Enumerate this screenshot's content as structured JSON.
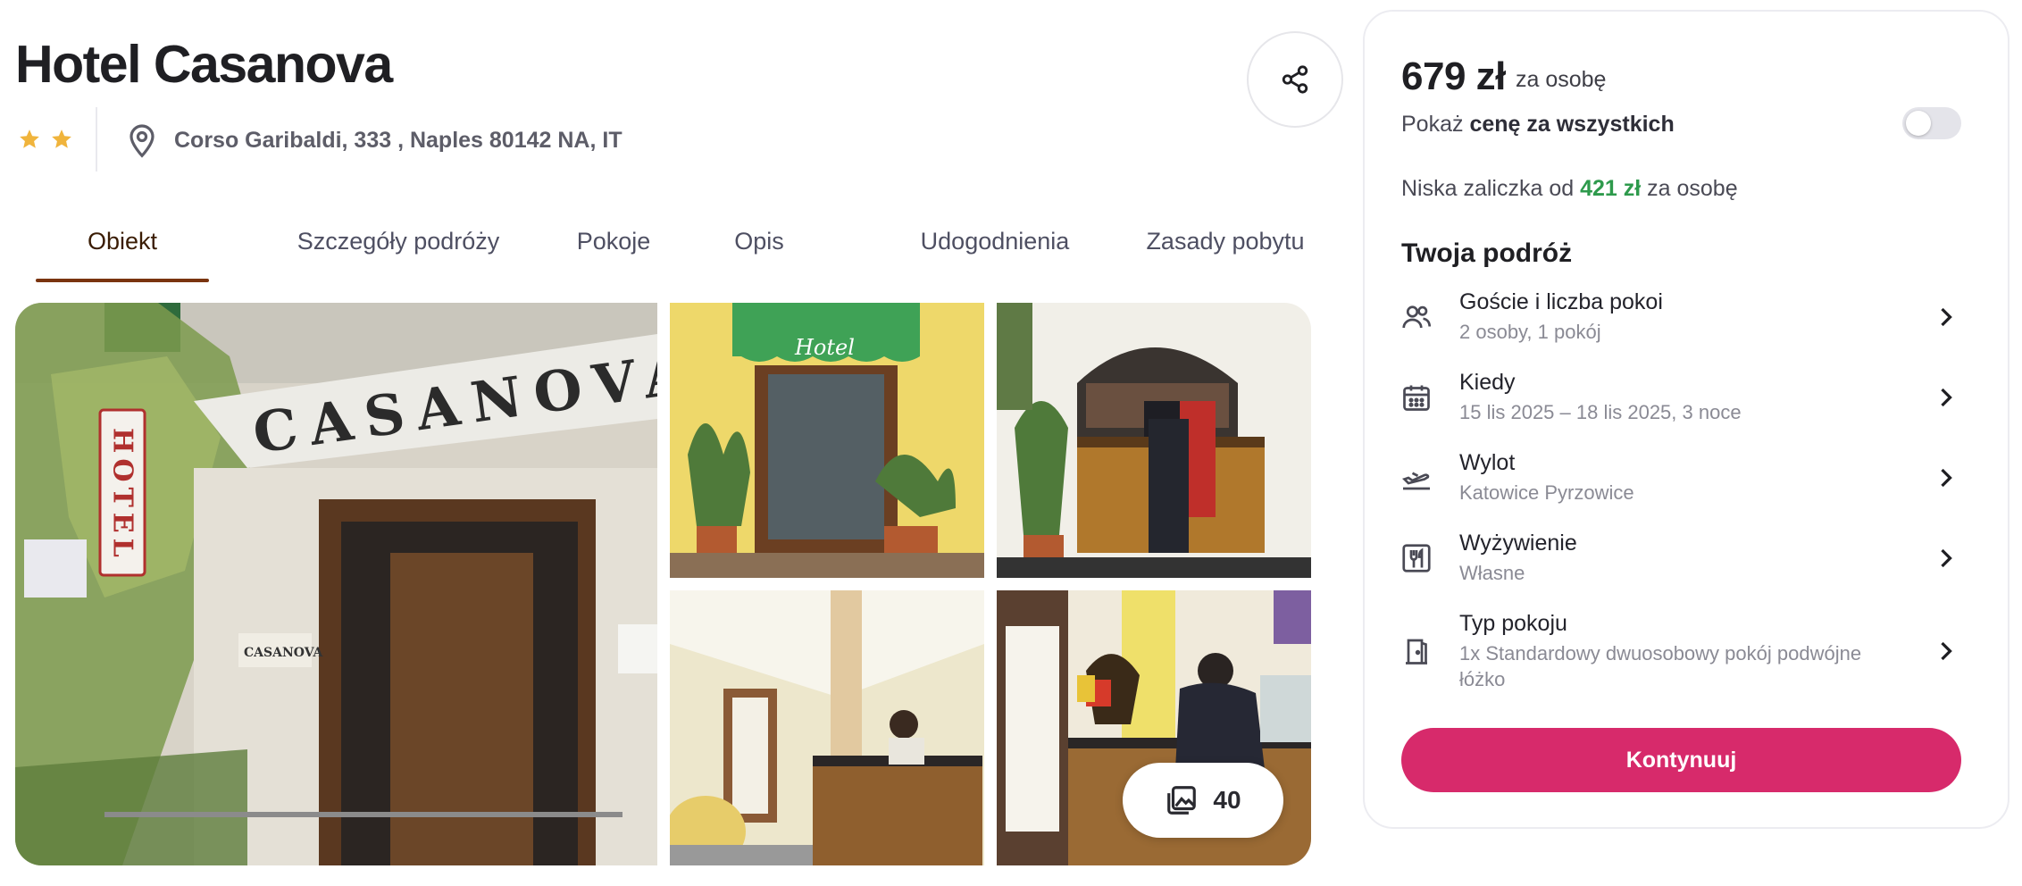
{
  "hotel": {
    "name": "Hotel Casanova",
    "stars": 2,
    "address": "Corso Garibaldi, 333 , Naples 80142 NA, IT"
  },
  "tabs": [
    {
      "label": "Obiekt",
      "active": true
    },
    {
      "label": "Szczegóły podróży",
      "active": false
    },
    {
      "label": "Pokoje",
      "active": false
    },
    {
      "label": "Opis",
      "active": false
    },
    {
      "label": "Udogodnienia",
      "active": false
    },
    {
      "label": "Zasady pobytu",
      "active": false
    }
  ],
  "gallery": {
    "photo_count": "40",
    "main_photo_sign": "CASANOVA",
    "main_photo_vertical_sign": "HOTEL",
    "main_photo_door_plaque": "CASANOVA",
    "awning_text": "Hotel"
  },
  "booking": {
    "price": "679 zł",
    "price_unit": "za osobę",
    "show_total_prefix": "Pokaż ",
    "show_total_bold": "cenę za wszystkich",
    "show_total_enabled": false,
    "deposit_prefix": "Niska zaliczka od ",
    "deposit_amount": "421 zł",
    "deposit_suffix": " za osobę",
    "trip_title": "Twoja podróż",
    "rows": [
      {
        "icon": "guests-icon",
        "title": "Goście i liczba pokoi",
        "value": "2 osoby, 1 pokój"
      },
      {
        "icon": "calendar-icon",
        "title": "Kiedy",
        "value": "15 lis 2025 – 18 lis 2025, 3 noce"
      },
      {
        "icon": "plane-icon",
        "title": "Wylot",
        "value": "Katowice Pyrzowice"
      },
      {
        "icon": "cutlery-icon",
        "title": "Wyżywienie",
        "value": "Własne"
      },
      {
        "icon": "door-icon",
        "title": "Typ pokoju",
        "value": "1x Standardowy dwuosobowy pokój podwójne łóżko"
      }
    ],
    "continue_label": "Kontynuuj"
  },
  "colors": {
    "accent": "#d72a6b",
    "star": "#f0b43c",
    "deposit_green": "#2e9a4c",
    "active_tab": "#7a3410"
  }
}
